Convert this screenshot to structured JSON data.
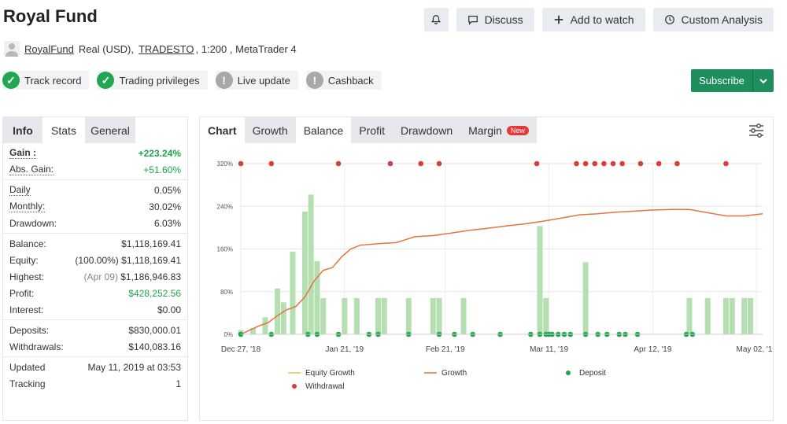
{
  "header": {
    "title": "Royal Fund",
    "discuss": "Discuss",
    "add_to_watch": "Add to watch",
    "custom_analysis": "Custom Analysis"
  },
  "account": {
    "name": "RoyalFund",
    "type": "Real (USD),",
    "broker": "TRADESTO",
    "rest": ", 1:200 , MetaTrader 4"
  },
  "badges": [
    {
      "label": "Track record",
      "status": "ok"
    },
    {
      "label": "Trading privileges",
      "status": "ok"
    },
    {
      "label": "Live update",
      "status": "warn"
    },
    {
      "label": "Cashback",
      "status": "warn"
    }
  ],
  "subscribe": "Subscribe",
  "left_tabs": [
    "Info",
    "Stats",
    "General"
  ],
  "stats": {
    "gain_label": "Gain :",
    "gain": "+223.24%",
    "abs_gain_label": "Abs. Gain:",
    "abs_gain": "+51.60%",
    "daily_label": "Daily",
    "daily": "0.05%",
    "monthly_label": "Monthly:",
    "monthly": "30.02%",
    "drawdown_label": "Drawdown:",
    "drawdown": "6.03%",
    "balance_label": "Balance:",
    "balance": "$1,118,169.41",
    "equity_label": "Equity:",
    "equity_pct": "(100.00%)",
    "equity": "$1,118,169.41",
    "highest_label": "Highest:",
    "highest_date": "(Apr 09)",
    "highest": "$1,186,946.83",
    "profit_label": "Profit:",
    "profit": "$428,252.56",
    "interest_label": "Interest:",
    "interest": "$0.00",
    "deposits_label": "Deposits:",
    "deposits": "$830,000.01",
    "withdrawals_label": "Withdrawals:",
    "withdrawals": "$140,083.16",
    "updated_label": "Updated",
    "updated": "May 11, 2019 at 03:53",
    "tracking_label": "Tracking",
    "tracking": "1"
  },
  "chart_tabs": {
    "chart": "Chart",
    "growth": "Growth",
    "balance": "Balance",
    "profit": "Profit",
    "drawdown": "Drawdown",
    "margin": "Margin",
    "new": "New"
  },
  "colors": {
    "growth": "#e8733c",
    "bar": "#b5dfb0",
    "deposit": "#1ea64a",
    "withdrawal": "#e03b3b",
    "equity": "#f0c040"
  },
  "chart_data": {
    "type": "line",
    "y_ticks": [
      "0%",
      "80%",
      "160%",
      "240%",
      "320%"
    ],
    "ylim": [
      0,
      320
    ],
    "x_ticks": [
      "Dec 27, '18",
      "Jan 21, '19",
      "Feb 21, '19",
      "Mar 11, '19",
      "Apr 12, '19",
      "May 02, '19"
    ],
    "legend": [
      "Equity Growth",
      "Growth",
      "Deposit",
      "Withdrawal"
    ],
    "growth_series": [
      [
        0,
        0
      ],
      [
        3,
        8
      ],
      [
        6,
        16
      ],
      [
        9,
        22
      ],
      [
        12,
        35
      ],
      [
        15,
        46
      ],
      [
        18,
        52
      ],
      [
        21,
        70
      ],
      [
        24,
        100
      ],
      [
        27,
        120
      ],
      [
        30,
        125
      ],
      [
        33,
        145
      ],
      [
        36,
        160
      ],
      [
        39,
        167
      ],
      [
        45,
        170
      ],
      [
        51,
        172
      ],
      [
        57,
        183
      ],
      [
        63,
        185
      ],
      [
        69,
        190
      ],
      [
        75,
        195
      ],
      [
        81,
        199
      ],
      [
        87,
        203
      ],
      [
        93,
        207
      ],
      [
        99,
        212
      ],
      [
        105,
        218
      ],
      [
        111,
        224
      ],
      [
        117,
        226
      ],
      [
        123,
        229
      ],
      [
        129,
        231
      ],
      [
        135,
        233
      ],
      [
        141,
        234
      ],
      [
        147,
        234
      ],
      [
        153,
        228
      ],
      [
        159,
        222
      ],
      [
        165,
        222
      ],
      [
        171,
        226
      ]
    ],
    "bars": [
      [
        0,
        8
      ],
      [
        4,
        12
      ],
      [
        8,
        32
      ],
      [
        12,
        86
      ],
      [
        14,
        60
      ],
      [
        17,
        155
      ],
      [
        21,
        230
      ],
      [
        23,
        262
      ],
      [
        25,
        137
      ],
      [
        27,
        68
      ],
      [
        34,
        68
      ],
      [
        38,
        68
      ],
      [
        45,
        68
      ],
      [
        47,
        68
      ],
      [
        55,
        68
      ],
      [
        63,
        68
      ],
      [
        65,
        68
      ],
      [
        73,
        68
      ],
      [
        98,
        203
      ],
      [
        100,
        68
      ],
      [
        113,
        135
      ],
      [
        147,
        68
      ],
      [
        153,
        68
      ],
      [
        159,
        68
      ],
      [
        161,
        68
      ],
      [
        165,
        68
      ],
      [
        167,
        68
      ]
    ],
    "deposits": [
      0,
      10,
      22,
      25,
      32,
      42,
      45,
      55,
      65,
      70,
      76,
      85,
      95,
      98,
      100,
      101,
      102,
      104,
      106,
      108,
      113,
      117,
      120,
      124,
      126,
      130,
      146,
      148
    ],
    "withdrawals": [
      0,
      10,
      32,
      49,
      59,
      65,
      97,
      110,
      113,
      116,
      119,
      122,
      125,
      131,
      137,
      143,
      159
    ]
  }
}
